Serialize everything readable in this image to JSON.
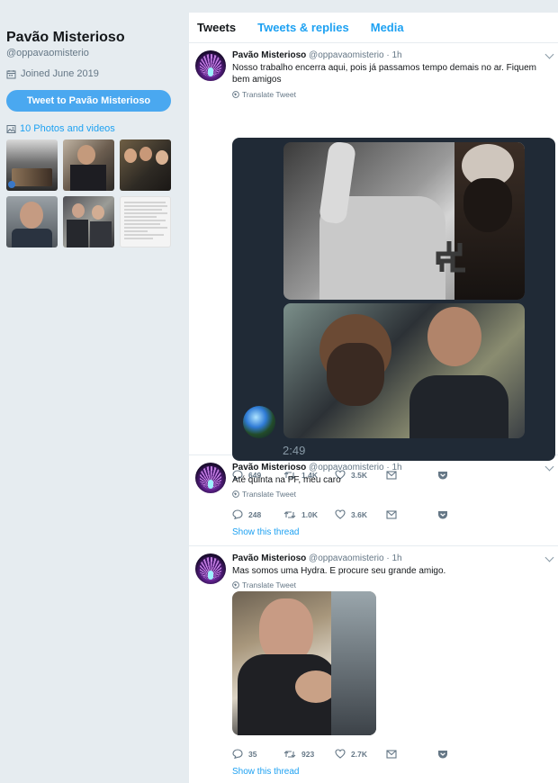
{
  "profile": {
    "name": "Pavão Misterioso",
    "handle": "@oppavaomisterio",
    "joined": "Joined June 2019",
    "tweet_to_label": "Tweet to Pavão Misterioso",
    "photos_label": "10 Photos and videos",
    "photo_thumbs": [
      "photo-1",
      "photo-2",
      "photo-3",
      "photo-4",
      "photo-5",
      "photo-6"
    ]
  },
  "tabs": [
    "Tweets",
    "Tweets & replies",
    "Media"
  ],
  "tweets": [
    {
      "name": "Pavão Misterioso",
      "handle": "@oppavaomisterio · 1h",
      "text": "Nosso trabalho encerra aqui, pois já passamos tempo demais no ar. Fiquem bem amigos",
      "translate": "Translate Tweet",
      "video_time": "2:49",
      "replies": "649",
      "retweets": "1.4K",
      "likes": "3.5K"
    },
    {
      "name": "Pavão Misterioso",
      "handle": "@oppavaomisterio · 1h",
      "text": "Até quinta na PF, meu caro",
      "translate": "Translate Tweet",
      "replies": "248",
      "retweets": "1.0K",
      "likes": "3.6K",
      "show_thread": "Show this thread"
    },
    {
      "name": "Pavão Misterioso",
      "handle": "@oppavaomisterio · 1h",
      "text": "Mas somos uma Hydra. E procure seu grande amigo.",
      "translate": "Translate Tweet",
      "replies": "35",
      "retweets": "923",
      "likes": "2.7K",
      "show_thread": "Show this thread"
    }
  ],
  "colors": {
    "accent": "#1da1f2",
    "button": "#4aa8f0",
    "background": "#e6ecf0",
    "muted": "#657786"
  }
}
